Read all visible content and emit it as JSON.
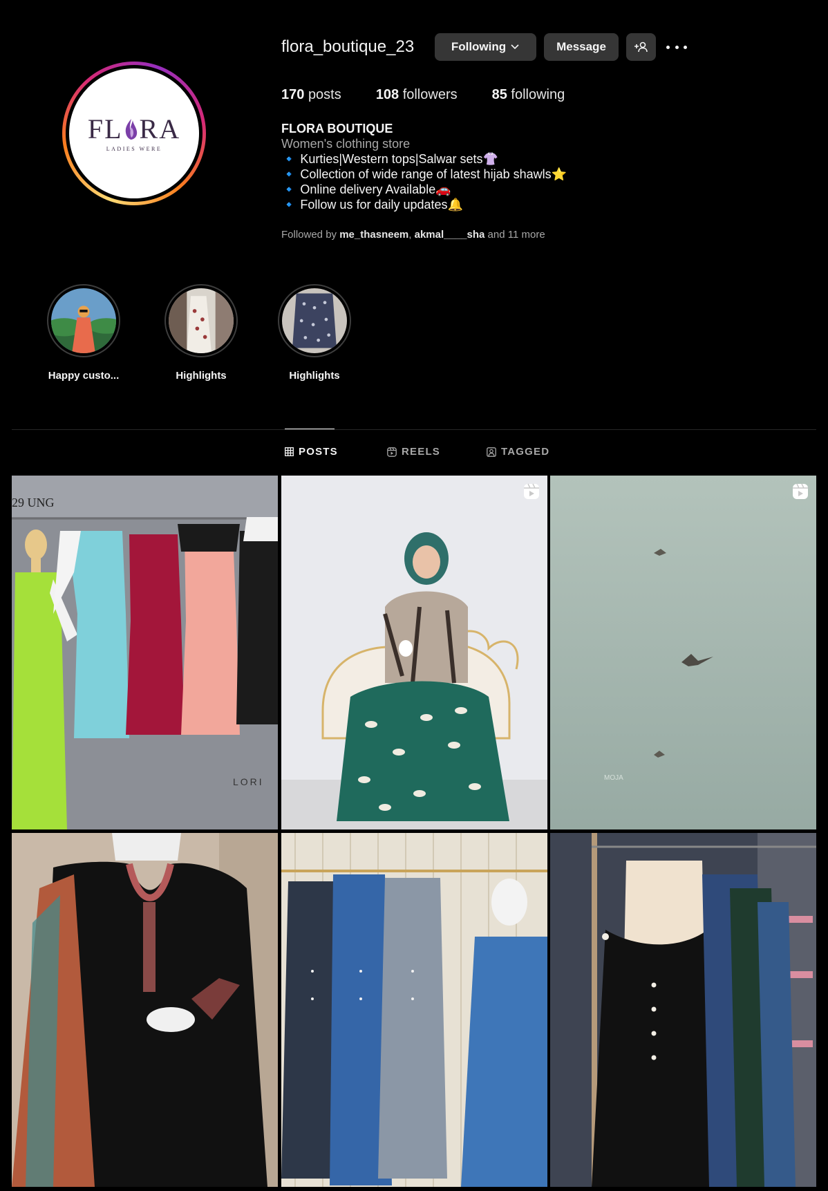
{
  "profile": {
    "username": "flora_boutique_23",
    "following_label": "Following",
    "message_label": "Message",
    "logo_text_left": "FL",
    "logo_text_right": "RA",
    "logo_tagline": "LADIES WERE",
    "stats": {
      "posts_count": "170",
      "posts_label": "posts",
      "followers_count": "108",
      "followers_label": "followers",
      "following_count": "85",
      "following_label": "following"
    },
    "bio": {
      "name": "FLORA BOUTIQUE",
      "category": "Women's clothing store",
      "lines": [
        "🔹 Kurties|Western tops|Salwar sets👚",
        "🔹 Collection of wide range of latest hijab shawls⭐",
        "🔹 Online delivery Available🚗",
        "🔹  Follow us for daily updates🔔"
      ]
    },
    "followed_by": {
      "prefix": "Followed by",
      "user1": "me_thasneem",
      "separator": ",",
      "user2": "akmal____sha",
      "suffix": "and 11 more"
    }
  },
  "highlights": [
    {
      "label": "Happy custo..."
    },
    {
      "label": "Highlights"
    },
    {
      "label": "Highlights"
    }
  ],
  "tabs": [
    {
      "label": "POSTS",
      "active": true
    },
    {
      "label": "REELS",
      "active": false
    },
    {
      "label": "TAGGED",
      "active": false
    }
  ],
  "posts": [
    {
      "kind": "photo",
      "overlay_text": "29 UNG",
      "brand_text": "LORI",
      "is_reel": false
    },
    {
      "kind": "photo",
      "is_reel": true
    },
    {
      "kind": "photo",
      "watermark": "MOJA",
      "is_reel": true
    },
    {
      "kind": "photo",
      "is_reel": false
    },
    {
      "kind": "photo",
      "is_reel": false
    },
    {
      "kind": "photo",
      "is_reel": false
    }
  ],
  "colors": {
    "background": "#000000",
    "button_bg": "#363636",
    "text_primary": "#f5f5f5",
    "text_secondary": "#a8a8a8",
    "story_ring": [
      "#feda75",
      "#fa7e1e",
      "#d62976",
      "#962fbf"
    ]
  },
  "icons": {
    "following_button": "chevron-down-icon",
    "add_user_button": "add-user-icon",
    "more": "more-options-icon",
    "posts_tab": "grid-icon",
    "reels_tab": "reels-icon",
    "tagged_tab": "tagged-icon",
    "reel_badge": "reel-icon"
  }
}
